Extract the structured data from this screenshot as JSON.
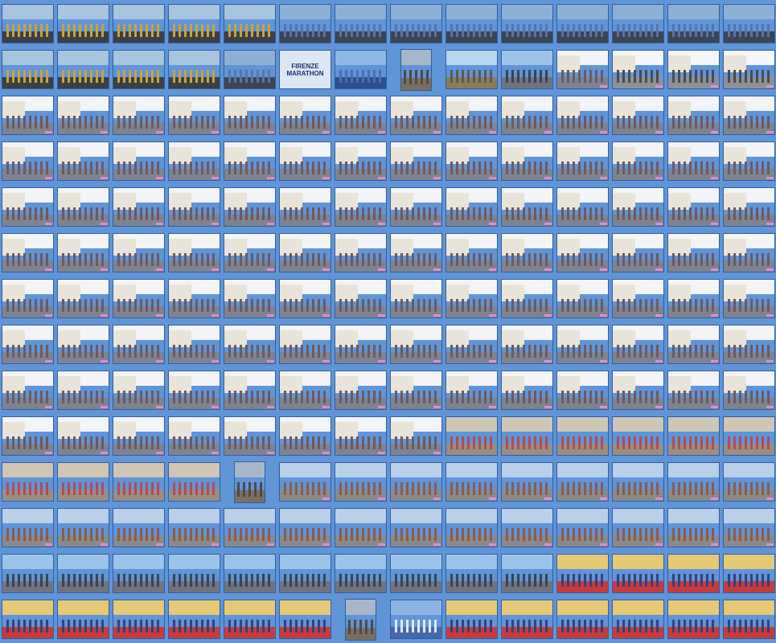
{
  "gallery": {
    "columns": 14,
    "background": "#6095d8",
    "banner_thumb": {
      "line1": "FIRENZE",
      "line2": "MARATHON"
    },
    "rows": [
      [
        "start",
        "start",
        "start",
        "start",
        "start",
        "crowd",
        "crowd",
        "crowd",
        "crowd",
        "crowd",
        "crowd",
        "crowd",
        "crowd",
        "crowd"
      ],
      [
        "start",
        "start",
        "start",
        "start",
        "crowd",
        "banner",
        "boats",
        "portrait",
        "gazebo",
        "river",
        "street",
        "road",
        "road",
        "road"
      ],
      [
        "street",
        "street",
        "street",
        "street",
        "street",
        "street",
        "street",
        "street",
        "street",
        "street",
        "street",
        "street",
        "street",
        "street"
      ],
      [
        "street",
        "street",
        "street",
        "street",
        "street",
        "street",
        "street",
        "street",
        "street",
        "street",
        "street",
        "street",
        "street",
        "street"
      ],
      [
        "street",
        "street",
        "street",
        "street",
        "street",
        "street",
        "street",
        "street",
        "street",
        "street",
        "street",
        "street",
        "street",
        "street"
      ],
      [
        "street",
        "street",
        "street",
        "street",
        "street",
        "street",
        "street",
        "street",
        "street",
        "street",
        "street",
        "street",
        "street",
        "street"
      ],
      [
        "street",
        "street",
        "street",
        "street",
        "street",
        "street",
        "street",
        "street",
        "street",
        "street",
        "street",
        "street",
        "street",
        "street"
      ],
      [
        "street",
        "street",
        "street",
        "street",
        "street",
        "street",
        "street",
        "street",
        "street",
        "street",
        "street",
        "street",
        "street",
        "street"
      ],
      [
        "street",
        "street",
        "street",
        "street",
        "street",
        "street",
        "street",
        "street",
        "street",
        "street",
        "street",
        "street",
        "street",
        "street"
      ],
      [
        "street",
        "street",
        "street",
        "street",
        "street",
        "street",
        "street",
        "street",
        "arcade",
        "arcade",
        "arcade",
        "arcade",
        "arcade",
        "arcade"
      ],
      [
        "arcade",
        "arcade",
        "arcade",
        "arcade",
        "portrait",
        "square",
        "square",
        "square",
        "square",
        "square",
        "square",
        "square",
        "square",
        "square"
      ],
      [
        "square",
        "square",
        "square",
        "square",
        "square",
        "square",
        "square",
        "square",
        "square",
        "square",
        "square",
        "square",
        "square",
        "square"
      ],
      [
        "river",
        "river",
        "river",
        "river",
        "river",
        "river",
        "river",
        "river",
        "river",
        "river",
        "finish",
        "finish",
        "finish",
        "finish"
      ],
      [
        "finish",
        "finish",
        "finish",
        "finish",
        "finish",
        "finish",
        "portrait",
        "medal",
        "finish",
        "finish",
        "finish",
        "finish",
        "finish",
        "finish"
      ]
    ]
  },
  "themes": {
    "start": {
      "sky": "#a9c4dd",
      "ground": "#3b3f46",
      "runners": "#c9a43a"
    },
    "crowd": {
      "sky": "#8fb0d6",
      "ground": "#3e4552",
      "runners": "#5a73a8"
    },
    "street": {
      "sky": "#f2f4f7",
      "ground": "#7d8490",
      "runners": "#6c5a61"
    },
    "road": {
      "sky": "#f4f6f8",
      "ground": "#8d9299",
      "runners": "#4d4b4b"
    },
    "arcade": {
      "sky": "#cfc6b3",
      "ground": "#9a8f82",
      "runners": "#b34a58"
    },
    "square": {
      "sky": "#b9d0e8",
      "ground": "#8a8a8a",
      "runners": "#8a5b4e"
    },
    "river": {
      "sky": "#9cc4ea",
      "ground": "#6f7580",
      "runners": "#3d4450"
    },
    "finish": {
      "sky": "#e6c977",
      "ground": "#c73b3b",
      "runners": "#39407a"
    },
    "boats": {
      "sky": "#8db7e6",
      "ground": "#2d4f8d",
      "runners": "#4a6fb0"
    },
    "gazebo": {
      "sky": "#b8d5ee",
      "ground": "#8b7b58",
      "runners": "#5e5a50"
    },
    "portrait": {
      "sky": "#a8b7c8",
      "ground": "#7b6f62",
      "runners": "#4f4a45"
    },
    "medal": {
      "sky": "#8fb5e3",
      "ground": "#4669a8",
      "runners": "#dfe8f4"
    }
  }
}
